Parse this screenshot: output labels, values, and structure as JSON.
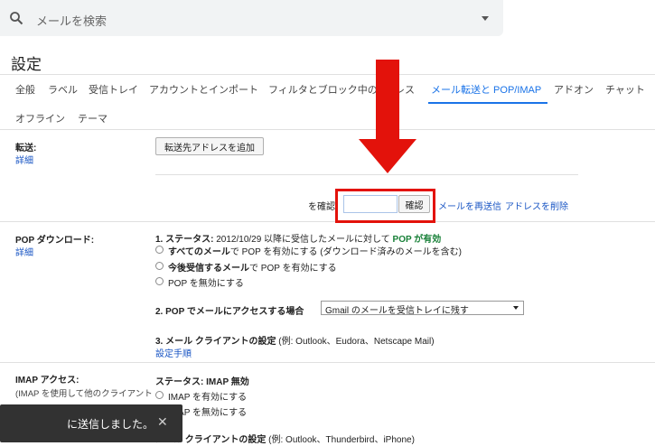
{
  "search": {
    "placeholder": "メールを検索"
  },
  "page_title": "設定",
  "tabs": [
    {
      "label": "全般"
    },
    {
      "label": "ラベル"
    },
    {
      "label": "受信トレイ"
    },
    {
      "label": "アカウントとインポート"
    },
    {
      "label": "フィルタとブロック中の"
    },
    {
      "label": "レス"
    },
    {
      "label": "メール転送と POP/IMAP"
    },
    {
      "label": "アドオン"
    },
    {
      "label": "チャット"
    }
  ],
  "tabs_row2": [
    {
      "label": "オフライン"
    },
    {
      "label": "テーマ"
    }
  ],
  "forwarding": {
    "label": "転送:",
    "details_link": "詳細",
    "add_button": "転送先アドレスを追加",
    "confirm_prefix": "を確認",
    "confirm_button": "確認",
    "resend_link": "メールを再送信",
    "delete_link": "アドレスを削除"
  },
  "pop": {
    "label": "POP ダウンロード:",
    "details_link": "詳細",
    "status_label": "1. ステータス:",
    "status_text": "2012/10/29 以降に受信したメールに対して",
    "status_value": "POP が有効",
    "options": [
      {
        "bold": "すべてのメール",
        "rest": "で POP を有効にする (ダウンロード済みのメールを含む)"
      },
      {
        "bold": "今後受信するメール",
        "rest": "で POP を有効にする"
      },
      {
        "bold": "",
        "rest": "POP を無効にする"
      }
    ],
    "access_label": "2. POP でメールにアクセスする場合",
    "access_select": "Gmail のメールを受信トレイに残す",
    "client_label": "3. メール クライアントの設定",
    "client_examples": "(例: Outlook、Eudora、Netscape Mail)",
    "setup_link": "設定手順"
  },
  "imap": {
    "label": "IMAP アクセス:",
    "sublabel": "(IMAP を使用して他のクライアント",
    "status": "ステータス: IMAP 無効",
    "enable": "IMAP を有効にする",
    "disable": "IMAP を無効にする",
    "client_label": "メール クライアントの設定",
    "client_examples": "(例: Outlook、Thunderbird、iPhone)"
  },
  "toast": {
    "text": "に送信しました。",
    "close": "✕"
  },
  "colors": {
    "accent": "#1a73e8",
    "highlight_red": "#e3120b",
    "pop_green": "#188038"
  }
}
